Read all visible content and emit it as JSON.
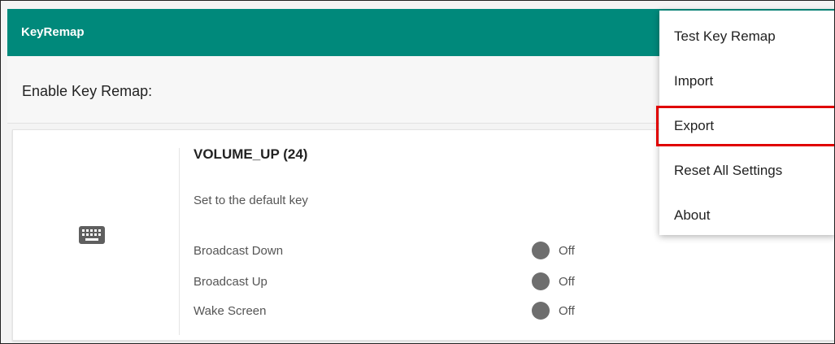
{
  "app": {
    "title": "KeyRemap"
  },
  "settings": {
    "enable_label": "Enable Key Remap:"
  },
  "key_card": {
    "key_name": "VOLUME_UP (24)",
    "subtitle": "Set to the default key",
    "options": [
      {
        "label": "Broadcast Down",
        "state": "Off"
      },
      {
        "label": "Broadcast Up",
        "state": "Off"
      },
      {
        "label": "Wake Screen",
        "state": "Off"
      }
    ],
    "icon": "keyboard-icon"
  },
  "menu": {
    "items": [
      {
        "label": "Test Key Remap"
      },
      {
        "label": "Import"
      },
      {
        "label": "Export"
      },
      {
        "label": "Reset All Settings"
      },
      {
        "label": "About"
      }
    ],
    "highlighted": "Export"
  },
  "colors": {
    "appbar": "#00897b",
    "highlight": "#e00000",
    "toggle_off": "#6e6e6e"
  }
}
